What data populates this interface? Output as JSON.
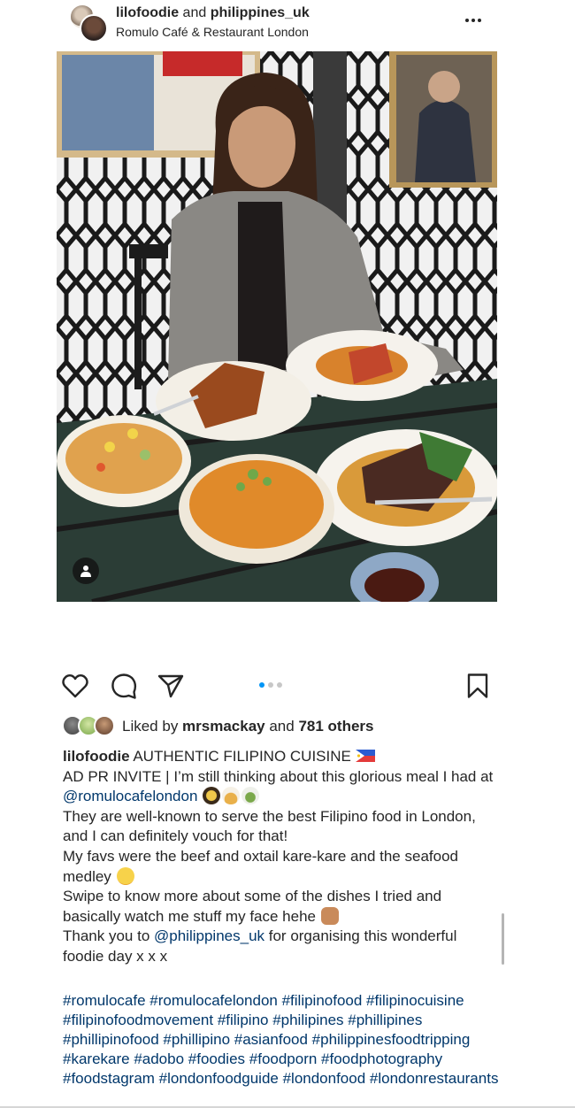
{
  "post": {
    "header": {
      "users_primary": "lilofoodie",
      "users_joiner": " and ",
      "users_secondary": "philippines_uk",
      "location": "Romulo Café & Restaurant London"
    },
    "carousel": {
      "count": 3,
      "active_index": 0
    },
    "likes": {
      "prefix": "Liked by ",
      "user": "mrsmackay",
      "joiner": " and ",
      "others": "781 others"
    },
    "caption": {
      "username": "lilofoodie",
      "line1": " AUTHENTIC FILIPINO CUISINE ",
      "line2a": "AD PR INVITE | I’m still thinking about this glorious meal I had at ",
      "mention1": "@romulocafelondon",
      "line3": "They are well-known to serve the best Filipino food in London, and I can definitely vouch for that!",
      "line4": "My favs were the beef and oxtail kare-kare and the seafood medley ",
      "line5": "Swipe to know more about some of the dishes I tried and basically watch me stuff my face hehe ",
      "line6a": "Thank you to ",
      "mention2": "@philippines_uk",
      "line6b": " for organising this wonderful foodie day x x x"
    },
    "hashtags": "#romulocafe #romulocafelondon #filipinofood #filipinocuisine #filipinofoodmovement #filipino #philipines #phillipines #phillipinofood #phillipino #asianfood #philippinesfoodtripping #karekare #adobo #foodies #foodporn #foodphotography #foodstagram #londonfoodguide #londonfood #londonrestaurants"
  },
  "colors": {
    "text": "#262626",
    "link": "#00376b",
    "carousel_active": "#0095f6",
    "carousel_inactive": "#c7c7c7"
  },
  "icons": [
    "heart-icon",
    "comment-icon",
    "share-icon",
    "bookmark-icon",
    "more-options-icon",
    "user-tag-icon"
  ]
}
